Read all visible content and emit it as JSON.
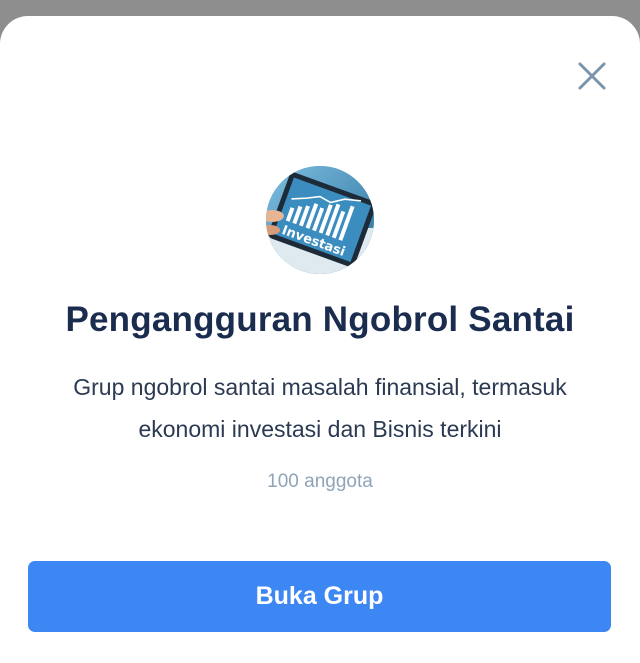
{
  "group": {
    "name": "Pengangguran Ngobrol Santai",
    "description": "Grup ngobrol santai masalah finansial, termasuk ekonomi investasi dan Bisnis terkini",
    "members": "100 anggota",
    "avatar_text": "Investasi"
  },
  "actions": {
    "open_label": "Buka Grup",
    "close_icon": "close-icon"
  },
  "colors": {
    "primary_button": "#3d87f5",
    "title_text": "#1b2d4f",
    "muted_text": "#8fa4b8",
    "close_icon": "#7a95ab"
  }
}
